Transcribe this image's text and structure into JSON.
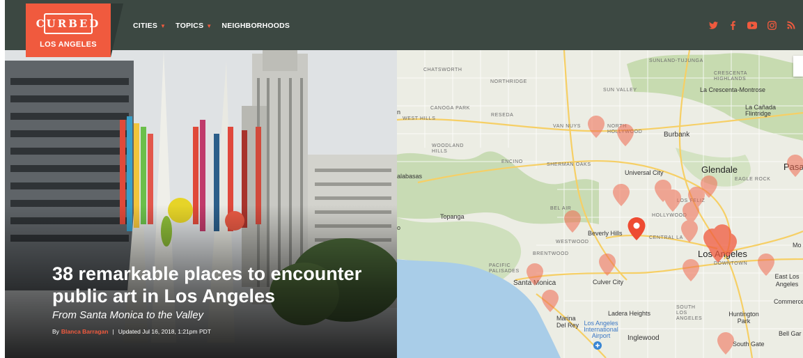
{
  "site": {
    "logo_word": "CURBED",
    "logo_city": "LOS ANGELES"
  },
  "nav": {
    "items": [
      {
        "label": "CITIES",
        "has_caret": true
      },
      {
        "label": "TOPICS",
        "has_caret": true
      },
      {
        "label": "NEIGHBORHOODS",
        "has_caret": false
      }
    ]
  },
  "social": [
    "twitter-icon",
    "facebook-icon",
    "youtube-icon",
    "instagram-icon",
    "rss-icon"
  ],
  "colors": {
    "nav_bg": "#3c4842",
    "brand": "#f05a3e",
    "map_pin": "#f06a50"
  },
  "article": {
    "headline": "38 remarkable places to encounter public art in Los Angeles",
    "dek": "From Santa Monica to the Valley",
    "by_prefix": "By",
    "author": "Blanca Barragan",
    "separator": "|",
    "updated": "Updated Jul 16, 2018, 1:21pm PDT"
  },
  "map": {
    "labels": [
      {
        "text": "SUNLAND-TUJUNGA",
        "style": "small"
      },
      {
        "text": "CRESCENTA HIGHLANDS",
        "style": "small"
      },
      {
        "text": "La Crescenta-Montrose",
        "style": "mid"
      },
      {
        "text": "CHATSWORTH",
        "style": "small"
      },
      {
        "text": "NORTHRIDGE",
        "style": "small"
      },
      {
        "text": "SUN VALLEY",
        "style": "small"
      },
      {
        "text": "La Cañada Flintridge",
        "style": "mid"
      },
      {
        "text": "CANOGA PARK",
        "style": "small"
      },
      {
        "text": "WEST HILLS",
        "style": "small"
      },
      {
        "text": "RESEDA",
        "style": "small"
      },
      {
        "text": "VAN NUYS",
        "style": "small"
      },
      {
        "text": "NORTH HOLLYWOOD",
        "style": "small"
      },
      {
        "text": "Burbank",
        "style": "big"
      },
      {
        "text": "WOODLAND HILLS",
        "style": "small"
      },
      {
        "text": "ENCINO",
        "style": "small"
      },
      {
        "text": "SHERMAN OAKS",
        "style": "small"
      },
      {
        "text": "Universal City",
        "style": "mid"
      },
      {
        "text": "Glendale",
        "style": "bigger"
      },
      {
        "text": "EAGLE ROCK",
        "style": "small"
      },
      {
        "text": "Pasa",
        "style": "bigger"
      },
      {
        "text": "alabasas",
        "style": "mid"
      },
      {
        "text": "LOS FELIZ",
        "style": "small"
      },
      {
        "text": "BEL AIR",
        "style": "small"
      },
      {
        "text": "HOLLYWOOD",
        "style": "small"
      },
      {
        "text": "Topanga",
        "style": "mid"
      },
      {
        "text": "Beverly Hills",
        "style": "mid"
      },
      {
        "text": "CENTRAL LA",
        "style": "small"
      },
      {
        "text": "WESTWOOD",
        "style": "small"
      },
      {
        "text": "BRENTWOOD",
        "style": "small"
      },
      {
        "text": "Los Angeles",
        "style": "bigger"
      },
      {
        "text": "DOWNTOWN",
        "style": "small"
      },
      {
        "text": "PACIFIC PALISADES",
        "style": "small"
      },
      {
        "text": "Santa Monica",
        "style": "big"
      },
      {
        "text": "Culver City",
        "style": "mid"
      },
      {
        "text": "East Los Angeles",
        "style": "mid"
      },
      {
        "text": "Commerce",
        "style": "mid"
      },
      {
        "text": "SOUTH LOS ANGELES",
        "style": "small"
      },
      {
        "text": "Ladera Heights",
        "style": "mid"
      },
      {
        "text": "Huntington Park",
        "style": "mid"
      },
      {
        "text": "Marina Del Rey",
        "style": "mid"
      },
      {
        "text": "Los Angeles International Airport",
        "style": "blue"
      },
      {
        "text": "Inglewood",
        "style": "big"
      },
      {
        "text": "Bell Gar",
        "style": "mid"
      },
      {
        "text": "South Gate",
        "style": "mid"
      },
      {
        "text": "n",
        "style": "mid"
      },
      {
        "text": "o",
        "style": "mid"
      },
      {
        "text": "Mo",
        "style": "mid"
      }
    ]
  }
}
